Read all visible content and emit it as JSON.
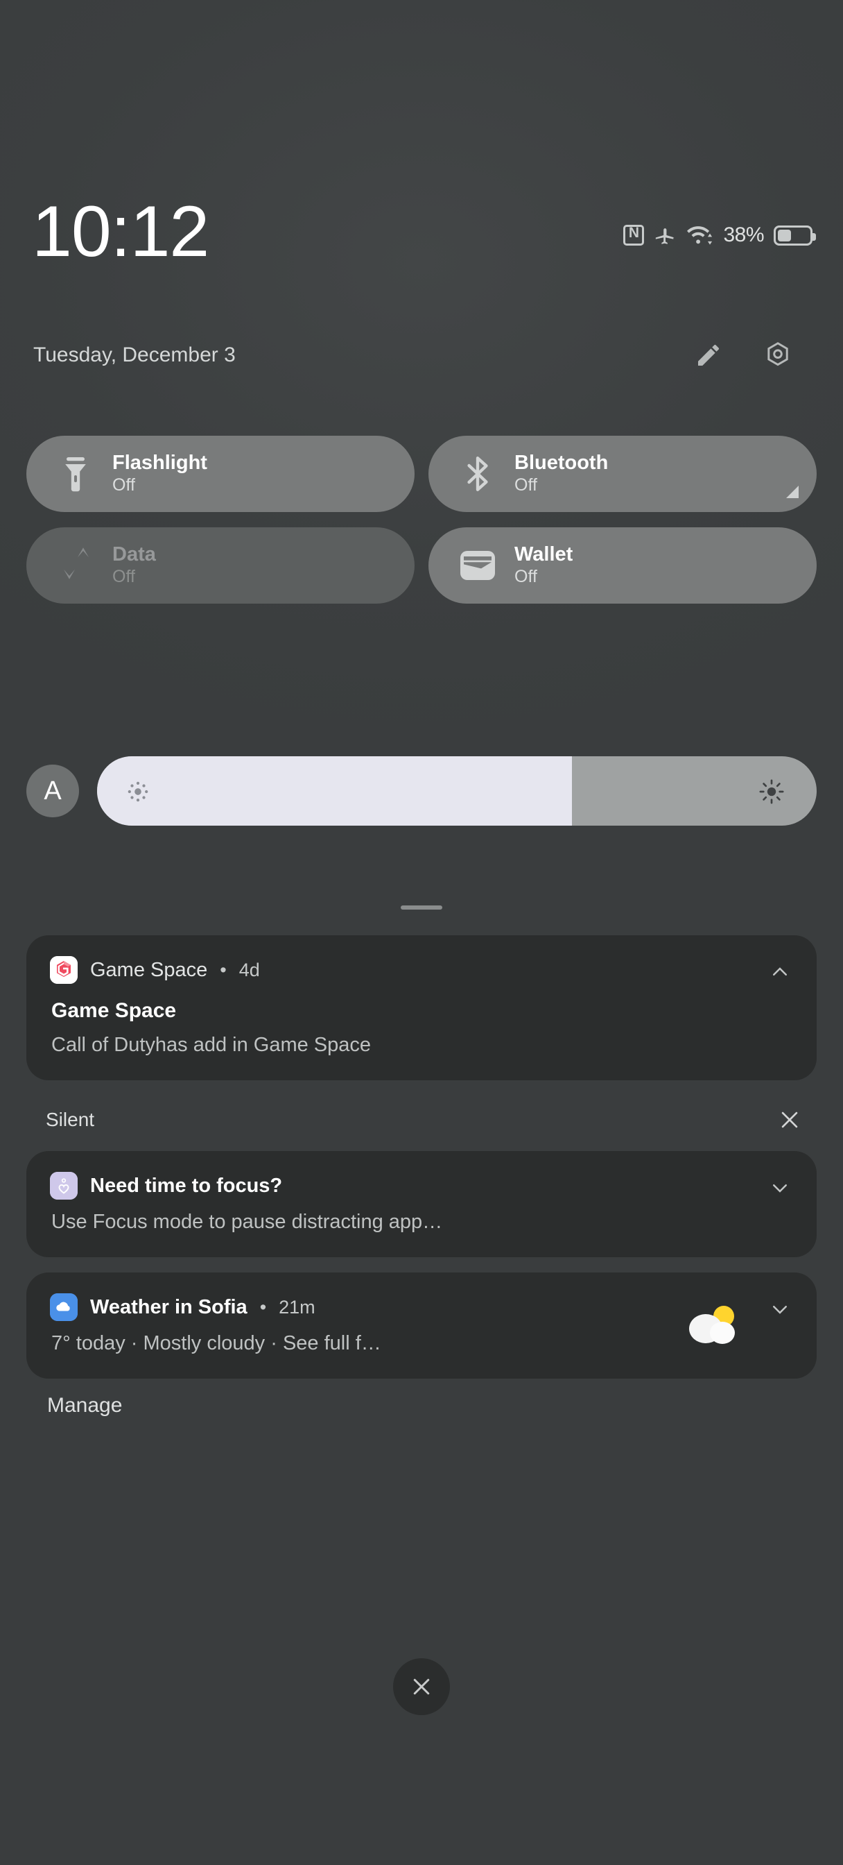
{
  "statusbar": {
    "clock": "10:12",
    "date": "Tuesday, December 3",
    "battery_percent": "38%",
    "battery_level": 38,
    "icons": [
      "nfc-icon",
      "airplane-mode-icon",
      "wifi-icon",
      "battery-icon"
    ]
  },
  "header": {
    "edit_icon": "pencil-icon",
    "settings_icon": "gear-icon"
  },
  "tiles": [
    {
      "title": "Flashlight",
      "state": "Off",
      "icon": "flashlight-icon",
      "enabled": true,
      "has_corner": false
    },
    {
      "title": "Bluetooth",
      "state": "Off",
      "icon": "bluetooth-icon",
      "enabled": true,
      "has_corner": true
    },
    {
      "title": "Data",
      "state": "Off",
      "icon": "data-transfer-icon",
      "enabled": false,
      "has_corner": false
    },
    {
      "title": "Wallet",
      "state": "Off",
      "icon": "wallet-icon",
      "enabled": true,
      "has_corner": false
    }
  ],
  "brightness": {
    "auto_label": "A",
    "value_percent": 66,
    "low_icon": "brightness-low-icon",
    "high_icon": "brightness-high-icon"
  },
  "notifications": [
    {
      "app": "Game Space",
      "time": "4d",
      "separator": "•",
      "title": "Game Space",
      "body": "Call of Dutyhas add in Game Space",
      "icon": "gamespace-icon",
      "chevron": "chevron-up-icon"
    },
    {
      "app": "Need time to focus?",
      "time": "",
      "separator": "",
      "title": "",
      "body": "Use Focus mode to pause distracting app…",
      "icon": "digital-wellbeing-icon",
      "chevron": "chevron-down-icon"
    },
    {
      "app": "Weather in Sofia",
      "time": "21m",
      "separator": "•",
      "title": "",
      "body": "7° today · Mostly cloudy · See full f…",
      "icon": "weather-icon",
      "chevron": "chevron-down-icon",
      "thumbnail": "partly-cloudy-icon"
    }
  ],
  "sections": {
    "silent_label": "Silent",
    "silent_clear_icon": "close-icon",
    "manage_label": "Manage"
  },
  "footer": {
    "close_all_icon": "close-icon"
  },
  "colors": {
    "background": "#3c3f40",
    "tile_active": "#797b7b",
    "tile_dim": "#5c5f5f",
    "notification_card": "#2b2d2d",
    "slider_fill": "#e6e6ef",
    "slider_track": "#9fa2a2",
    "weather_blue": "#4a90e8",
    "wellbeing_lavender": "#cfc8ea",
    "gamespace_red": "#e8354f"
  }
}
